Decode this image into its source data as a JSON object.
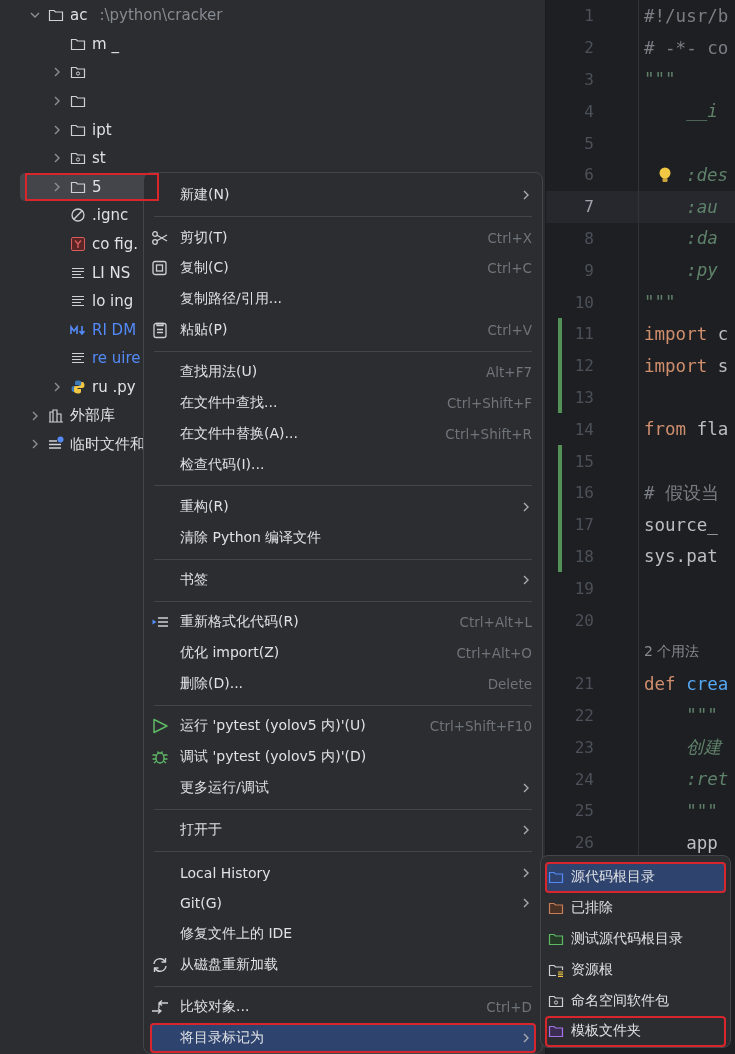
{
  "project_tree": {
    "items": [
      {
        "kind": "folder",
        "name": "ac",
        "path": ":\\python\\cracker",
        "expanded": true,
        "selected": false,
        "annotated": false,
        "modified": false,
        "children": [
          {
            "kind": "folder",
            "name": "m _",
            "selected": false,
            "annotated": false,
            "modified": false
          },
          {
            "kind": "namespace-folder",
            "expanded": false,
            "selected": false,
            "annotated": false
          },
          {
            "kind": "folder",
            "expanded": false,
            "selected": false,
            "annotated": false
          },
          {
            "kind": "folder",
            "name": "ipt",
            "expanded": false,
            "selected": false,
            "annotated": false,
            "modified": false
          },
          {
            "kind": "namespace-folder",
            "name": "st",
            "expanded": false,
            "selected": false,
            "annotated": false,
            "modified": false
          },
          {
            "kind": "folder",
            "name": "5",
            "expanded": false,
            "selected": true,
            "annotated": true,
            "modified": false
          },
          {
            "kind": "ignore",
            "name": ".ignc",
            "selected": false,
            "annotated": false,
            "modified": false
          },
          {
            "kind": "yaml",
            "name": "co fig.",
            "selected": false,
            "annotated": false,
            "modified": false
          },
          {
            "kind": "text",
            "name": "LI NS",
            "selected": false,
            "annotated": false,
            "modified": false
          },
          {
            "kind": "text",
            "name": "lo ing",
            "selected": false,
            "annotated": false,
            "modified": false
          },
          {
            "kind": "markdown",
            "name": "RI DM",
            "selected": false,
            "annotated": false,
            "modified": true
          },
          {
            "kind": "text",
            "name": "re uire",
            "selected": false,
            "annotated": false,
            "modified": true
          },
          {
            "kind": "python",
            "name": "ru .py",
            "expanded": false,
            "selected": false,
            "annotated": false,
            "modified": false
          }
        ]
      },
      {
        "kind": "library",
        "name": "外部库",
        "expanded": false,
        "selected": false,
        "annotated": false,
        "modified": false
      },
      {
        "kind": "scratch",
        "name": "临时文件和",
        "expanded": false,
        "selected": false,
        "annotated": false,
        "modified": false
      }
    ]
  },
  "editor": {
    "lines": [
      {
        "kind": "code",
        "number": "1",
        "current": false,
        "changed": false,
        "tokens": [
          {
            "kind": "comment",
            "text": "#!/usr/b"
          }
        ]
      },
      {
        "kind": "code",
        "number": "2",
        "current": false,
        "changed": false,
        "tokens": [
          {
            "kind": "comment",
            "text": "# -*- co"
          }
        ]
      },
      {
        "kind": "code",
        "number": "3",
        "current": false,
        "changed": false,
        "tokens": [
          {
            "kind": "docstring",
            "text": "\"\"\""
          }
        ]
      },
      {
        "kind": "code",
        "number": "4",
        "current": false,
        "changed": false,
        "tokens": [
          {
            "kind": "docstring",
            "text": "    __i"
          }
        ]
      },
      {
        "kind": "code",
        "number": "5",
        "current": false,
        "changed": false
      },
      {
        "kind": "code",
        "number": "6",
        "current": false,
        "changed": false,
        "intention": true,
        "tokens": [
          {
            "kind": "docstring",
            "text": ":des"
          }
        ]
      },
      {
        "kind": "code",
        "number": "7",
        "current": true,
        "changed": false,
        "tokens": [
          {
            "kind": "docstring",
            "text": "    :au"
          }
        ]
      },
      {
        "kind": "code",
        "number": "8",
        "current": false,
        "changed": false,
        "tokens": [
          {
            "kind": "docstring",
            "text": "    :da"
          }
        ]
      },
      {
        "kind": "code",
        "number": "9",
        "current": false,
        "changed": false,
        "tokens": [
          {
            "kind": "docstring",
            "text": "    :py"
          }
        ]
      },
      {
        "kind": "code",
        "number": "10",
        "current": false,
        "changed": false,
        "tokens": [
          {
            "kind": "docstring",
            "text": "\"\"\""
          }
        ]
      },
      {
        "kind": "code",
        "number": "11",
        "current": false,
        "changed": true,
        "tokens": [
          {
            "kind": "keyword",
            "text": "import"
          },
          {
            "kind": "plain",
            "text": " c"
          }
        ]
      },
      {
        "kind": "code",
        "number": "12",
        "current": false,
        "changed": true,
        "tokens": [
          {
            "kind": "keyword",
            "text": "import"
          },
          {
            "kind": "plain",
            "text": " s"
          }
        ]
      },
      {
        "kind": "code",
        "number": "13",
        "current": false,
        "changed": true
      },
      {
        "kind": "code",
        "number": "14",
        "current": false,
        "changed": false,
        "tokens": [
          {
            "kind": "keyword",
            "text": "from"
          },
          {
            "kind": "plain",
            "text": " fla"
          }
        ]
      },
      {
        "kind": "code",
        "number": "15",
        "current": false,
        "changed": true
      },
      {
        "kind": "code",
        "number": "16",
        "current": false,
        "changed": true,
        "tokens": [
          {
            "kind": "comment",
            "text": "# 假设当"
          }
        ]
      },
      {
        "kind": "code",
        "number": "17",
        "current": false,
        "changed": true,
        "tokens": [
          {
            "kind": "plain",
            "text": "source_"
          }
        ]
      },
      {
        "kind": "code",
        "number": "18",
        "current": false,
        "changed": true,
        "tokens": [
          {
            "kind": "plain",
            "text": "sys.pat"
          }
        ]
      },
      {
        "kind": "code",
        "number": "19",
        "current": false,
        "changed": false
      },
      {
        "kind": "code",
        "number": "20",
        "current": false,
        "changed": false
      },
      {
        "kind": "hint",
        "text": "2 个用法"
      },
      {
        "kind": "code",
        "number": "21",
        "current": false,
        "changed": false,
        "tokens": [
          {
            "kind": "keyword",
            "text": "def"
          },
          {
            "kind": "function",
            "text": " crea"
          }
        ]
      },
      {
        "kind": "code",
        "number": "22",
        "current": false,
        "changed": false,
        "tokens": [
          {
            "kind": "docstring",
            "text": "    \"\"\""
          }
        ]
      },
      {
        "kind": "code",
        "number": "23",
        "current": false,
        "changed": false,
        "tokens": [
          {
            "kind": "docstring",
            "text": "    创建"
          }
        ]
      },
      {
        "kind": "code",
        "number": "24",
        "current": false,
        "changed": false,
        "tokens": [
          {
            "kind": "docstring",
            "text": "    :ret"
          }
        ]
      },
      {
        "kind": "code",
        "number": "25",
        "current": false,
        "changed": false,
        "tokens": [
          {
            "kind": "docstring",
            "text": "    \"\"\""
          }
        ]
      },
      {
        "kind": "code",
        "number": "26",
        "current": false,
        "changed": false,
        "tokens": [
          {
            "kind": "plain",
            "text": "    app"
          }
        ]
      }
    ]
  },
  "context_menu": {
    "items": [
      {
        "kind": "plain",
        "label": "新建(N)",
        "submenu": true,
        "selected": false,
        "annotated": false
      },
      {
        "kind": "separator"
      },
      {
        "kind": "scissors",
        "label": "剪切(T)",
        "shortcut": "Ctrl+X",
        "submenu": false,
        "selected": false,
        "annotated": false
      },
      {
        "kind": "copy",
        "label": "复制(C)",
        "shortcut": "Ctrl+C",
        "submenu": false,
        "selected": false,
        "annotated": false
      },
      {
        "kind": "plain",
        "label": "复制路径/引用...",
        "submenu": false,
        "selected": false,
        "annotated": false
      },
      {
        "kind": "paste",
        "label": "粘贴(P)",
        "shortcut": "Ctrl+V",
        "submenu": false,
        "selected": false,
        "annotated": false
      },
      {
        "kind": "separator"
      },
      {
        "kind": "plain",
        "label": "查找用法(U)",
        "shortcut": "Alt+F7",
        "submenu": false,
        "selected": false,
        "annotated": false
      },
      {
        "kind": "plain",
        "label": "在文件中查找...",
        "shortcut": "Ctrl+Shift+F",
        "submenu": false,
        "selected": false,
        "annotated": false
      },
      {
        "kind": "plain",
        "label": "在文件中替换(A)...",
        "shortcut": "Ctrl+Shift+R",
        "submenu": false,
        "selected": false,
        "annotated": false
      },
      {
        "kind": "plain",
        "label": "检查代码(I)...",
        "submenu": false,
        "selected": false,
        "annotated": false
      },
      {
        "kind": "separator"
      },
      {
        "kind": "plain",
        "label": "重构(R)",
        "submenu": true,
        "selected": false,
        "annotated": false
      },
      {
        "kind": "plain",
        "label": "清除 Python 编译文件",
        "submenu": false,
        "selected": false,
        "annotated": false
      },
      {
        "kind": "separator"
      },
      {
        "kind": "plain",
        "label": "书签",
        "submenu": true,
        "selected": false,
        "annotated": false
      },
      {
        "kind": "separator"
      },
      {
        "kind": "reformat",
        "label": "重新格式化代码(R)",
        "shortcut": "Ctrl+Alt+L",
        "submenu": false,
        "selected": false,
        "annotated": false
      },
      {
        "kind": "plain",
        "label": "优化 import(Z)",
        "shortcut": "Ctrl+Alt+O",
        "submenu": false,
        "selected": false,
        "annotated": false
      },
      {
        "kind": "plain",
        "label": "删除(D)...",
        "shortcut": "Delete",
        "submenu": false,
        "selected": false,
        "annotated": false
      },
      {
        "kind": "separator"
      },
      {
        "kind": "run",
        "label": "运行 'pytest (yolov5 内)'(U)",
        "shortcut": "Ctrl+Shift+F10",
        "submenu": false,
        "selected": false,
        "annotated": false
      },
      {
        "kind": "debug",
        "label": "调试 'pytest (yolov5 内)'(D)",
        "submenu": false,
        "selected": false,
        "annotated": false
      },
      {
        "kind": "plain",
        "label": "更多运行/调试",
        "submenu": true,
        "selected": false,
        "annotated": false
      },
      {
        "kind": "separator"
      },
      {
        "kind": "plain",
        "label": "打开于",
        "submenu": true,
        "selected": false,
        "annotated": false
      },
      {
        "kind": "separator"
      },
      {
        "kind": "plain",
        "label": "Local History",
        "submenu": true,
        "selected": false,
        "annotated": false
      },
      {
        "kind": "plain",
        "label": "Git(G)",
        "submenu": true,
        "selected": false,
        "annotated": false
      },
      {
        "kind": "plain",
        "label": "修复文件上的 IDE",
        "submenu": false,
        "selected": false,
        "annotated": false
      },
      {
        "kind": "reload",
        "label": "从磁盘重新加载",
        "submenu": false,
        "selected": false,
        "annotated": false
      },
      {
        "kind": "separator"
      },
      {
        "kind": "compare",
        "label": "比较对象...",
        "shortcut": "Ctrl+D",
        "submenu": false,
        "selected": false,
        "annotated": false
      },
      {
        "kind": "plain",
        "label": "将目录标记为",
        "submenu": true,
        "selected": true,
        "annotated": true
      }
    ]
  },
  "submenu": {
    "items": [
      {
        "kind": "source-folder",
        "label": "源代码根目录",
        "selected": true,
        "annotated": true
      },
      {
        "kind": "excluded-folder",
        "label": "已排除",
        "selected": false,
        "annotated": false
      },
      {
        "kind": "test-folder",
        "label": "测试源代码根目录",
        "selected": false,
        "annotated": false
      },
      {
        "kind": "resource-folder",
        "label": "资源根",
        "selected": false,
        "annotated": false
      },
      {
        "kind": "namespace-folder",
        "label": "命名空间软件包",
        "selected": false,
        "annotated": false
      },
      {
        "kind": "template-folder",
        "label": "模板文件夹",
        "selected": false,
        "annotated": true
      }
    ]
  }
}
